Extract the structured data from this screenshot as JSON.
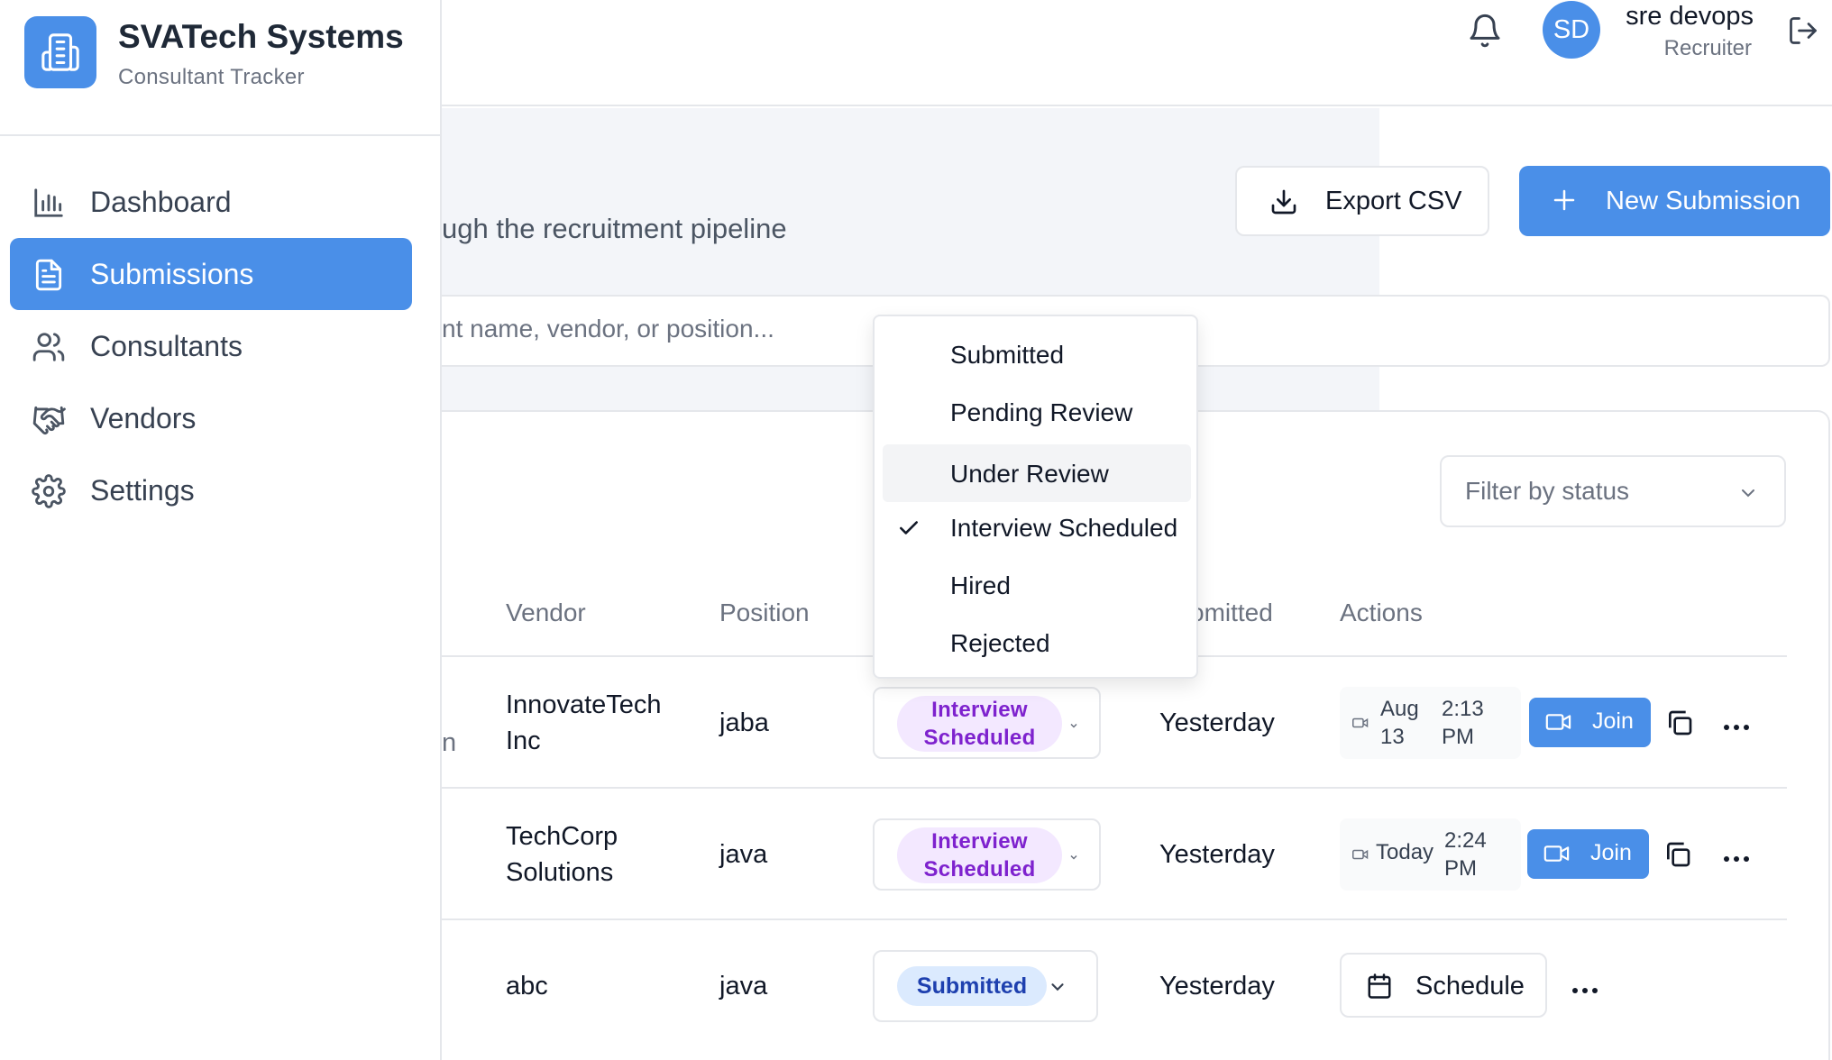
{
  "brand": {
    "title": "SVATech Systems",
    "subtitle": "Consultant Tracker"
  },
  "sidebar": {
    "items": [
      {
        "label": "Dashboard",
        "icon": "bar-chart-icon",
        "active": false
      },
      {
        "label": "Submissions",
        "icon": "document-icon",
        "active": true
      },
      {
        "label": "Consultants",
        "icon": "users-icon",
        "active": false
      },
      {
        "label": "Vendors",
        "icon": "handshake-icon",
        "active": false
      },
      {
        "label": "Settings",
        "icon": "gear-icon",
        "active": false
      }
    ]
  },
  "header": {
    "avatar_initials": "SD",
    "user_name": "sre devops",
    "user_role": "Recruiter"
  },
  "page": {
    "subtitle_visible": "ugh the recruitment pipeline",
    "export_label": "Export CSV",
    "new_label": "New Submission"
  },
  "search": {
    "placeholder_visible": "nt name, vendor, or position..."
  },
  "filter": {
    "placeholder": "Filter by status"
  },
  "table": {
    "columns": {
      "vendor": "Vendor",
      "position": "Position",
      "submitted": "omitted",
      "actions": "Actions"
    },
    "rows": [
      {
        "cut": "n",
        "vendor_line1": "InnovateTech",
        "vendor_line2": "Inc",
        "position": "jaba",
        "status_line1": "Interview",
        "status_line2": "Scheduled",
        "submitted": "Yesterday",
        "date_line1": "Aug",
        "date_line2": "13",
        "time_line1": "2:13",
        "time_line2": "PM",
        "join_label": "Join"
      },
      {
        "cut": "",
        "vendor_line1": "TechCorp",
        "vendor_line2": "Solutions",
        "position": "java",
        "status_line1": "Interview",
        "status_line2": "Scheduled",
        "submitted": "Yesterday",
        "date_single": "Today",
        "time_line1": "2:24",
        "time_line2": "PM",
        "join_label": "Join"
      },
      {
        "cut": "",
        "vendor_line1": "abc",
        "position": "java",
        "status": "Submitted",
        "submitted": "Yesterday",
        "schedule_label": "Schedule"
      }
    ]
  },
  "status_dropdown": {
    "options": [
      "Submitted",
      "Pending Review",
      "Under Review",
      "Interview Scheduled",
      "Hired",
      "Rejected"
    ],
    "selected": "Interview Scheduled",
    "highlighted": "Under Review"
  },
  "colors": {
    "accent": "#4a8fe8",
    "purple_pill_bg": "#f3e8ff",
    "purple_pill_text": "#7e22ce",
    "blue_pill_bg": "#dbeafe",
    "blue_pill_text": "#1e40af"
  }
}
